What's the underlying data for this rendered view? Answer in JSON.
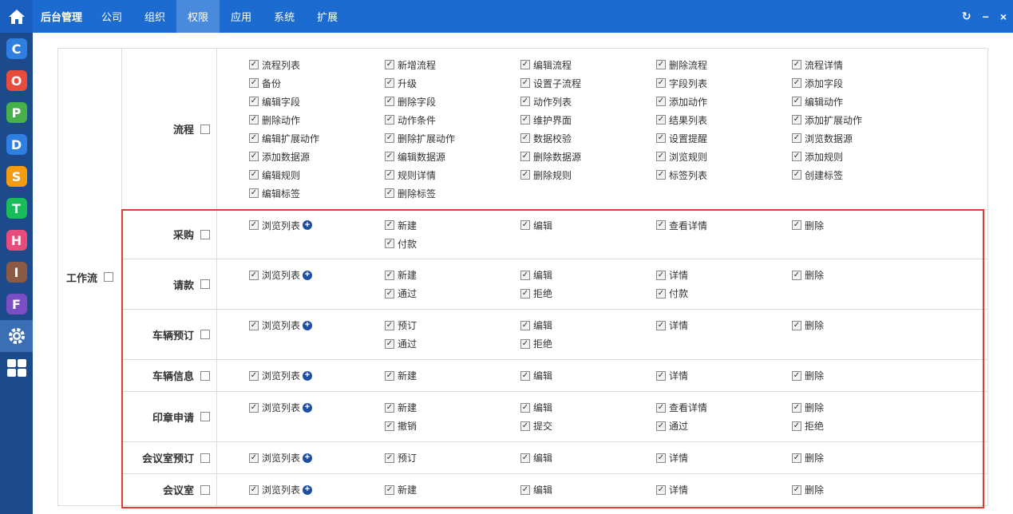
{
  "brand": "后台管理",
  "nav": [
    {
      "label": "公司",
      "active": false
    },
    {
      "label": "组织",
      "active": false
    },
    {
      "label": "权限",
      "active": true
    },
    {
      "label": "应用",
      "active": false
    },
    {
      "label": "系统",
      "active": false
    },
    {
      "label": "扩展",
      "active": false
    }
  ],
  "window_controls": {
    "refresh": "↻",
    "minimize": "−",
    "close": "×"
  },
  "sidebar": [
    {
      "letter": "C",
      "color": "#2f7fe0",
      "name": "sidebar-app-c"
    },
    {
      "letter": "O",
      "color": "#e84c3d",
      "name": "sidebar-app-o"
    },
    {
      "letter": "P",
      "color": "#46b14b",
      "name": "sidebar-app-p"
    },
    {
      "letter": "D",
      "color": "#2f7fe0",
      "name": "sidebar-app-d"
    },
    {
      "letter": "S",
      "color": "#f39c12",
      "name": "sidebar-app-s"
    },
    {
      "letter": "T",
      "color": "#1abc5a",
      "name": "sidebar-app-t"
    },
    {
      "letter": "H",
      "color": "#e84c7d",
      "name": "sidebar-app-h"
    },
    {
      "letter": "I",
      "color": "#8a5a44",
      "name": "sidebar-app-i"
    },
    {
      "letter": "F",
      "color": "#7b4fc4",
      "name": "sidebar-app-f"
    }
  ],
  "group_label": "工作流",
  "sections": [
    {
      "label": "流程",
      "items": [
        {
          "t": "流程列表"
        },
        {
          "t": "新增流程"
        },
        {
          "t": "编辑流程"
        },
        {
          "t": "删除流程"
        },
        {
          "t": "流程详情"
        },
        {
          "t": "备份"
        },
        {
          "t": "升级"
        },
        {
          "t": "设置子流程"
        },
        {
          "t": "字段列表"
        },
        {
          "t": "添加字段"
        },
        {
          "t": "编辑字段"
        },
        {
          "t": "删除字段"
        },
        {
          "t": "动作列表"
        },
        {
          "t": "添加动作"
        },
        {
          "t": "编辑动作"
        },
        {
          "t": "删除动作"
        },
        {
          "t": "动作条件"
        },
        {
          "t": "维护界面"
        },
        {
          "t": "结果列表"
        },
        {
          "t": "添加扩展动作"
        },
        {
          "t": "编辑扩展动作"
        },
        {
          "t": "删除扩展动作"
        },
        {
          "t": "数据校验"
        },
        {
          "t": "设置提醒"
        },
        {
          "t": "浏览数据源"
        },
        {
          "t": "添加数据源"
        },
        {
          "t": "编辑数据源"
        },
        {
          "t": "删除数据源"
        },
        {
          "t": "浏览规则"
        },
        {
          "t": "添加规则"
        },
        {
          "t": "编辑规则"
        },
        {
          "t": "规则详情"
        },
        {
          "t": "删除规则"
        },
        {
          "t": "标签列表"
        },
        {
          "t": "创建标签"
        },
        {
          "t": "编辑标签"
        },
        {
          "t": "删除标签"
        }
      ]
    },
    {
      "label": "采购",
      "items": [
        {
          "t": "浏览列表",
          "plus": true
        },
        {
          "t": "新建"
        },
        {
          "t": "编辑"
        },
        {
          "t": "查看详情"
        },
        {
          "t": "删除"
        },
        {
          "t": "",
          "empty": true
        },
        {
          "t": "付款"
        }
      ]
    },
    {
      "label": "请款",
      "items": [
        {
          "t": "浏览列表",
          "plus": true
        },
        {
          "t": "新建"
        },
        {
          "t": "编辑"
        },
        {
          "t": "详情"
        },
        {
          "t": "删除"
        },
        {
          "t": "",
          "empty": true
        },
        {
          "t": "通过"
        },
        {
          "t": "拒绝"
        },
        {
          "t": "付款"
        }
      ]
    },
    {
      "label": "车辆预订",
      "items": [
        {
          "t": "浏览列表",
          "plus": true
        },
        {
          "t": "预订"
        },
        {
          "t": "编辑"
        },
        {
          "t": "详情"
        },
        {
          "t": "删除"
        },
        {
          "t": "",
          "empty": true
        },
        {
          "t": "通过"
        },
        {
          "t": "拒绝"
        }
      ]
    },
    {
      "label": "车辆信息",
      "items": [
        {
          "t": "浏览列表",
          "plus": true
        },
        {
          "t": "新建"
        },
        {
          "t": "编辑"
        },
        {
          "t": "详情"
        },
        {
          "t": "删除"
        }
      ]
    },
    {
      "label": "印章申请",
      "items": [
        {
          "t": "浏览列表",
          "plus": true
        },
        {
          "t": "新建"
        },
        {
          "t": "编辑"
        },
        {
          "t": "查看详情"
        },
        {
          "t": "删除"
        },
        {
          "t": "",
          "empty": true
        },
        {
          "t": "撤销"
        },
        {
          "t": "提交"
        },
        {
          "t": "通过"
        },
        {
          "t": "拒绝"
        }
      ]
    },
    {
      "label": "会议室预订",
      "items": [
        {
          "t": "浏览列表",
          "plus": true
        },
        {
          "t": "预订"
        },
        {
          "t": "编辑"
        },
        {
          "t": "详情"
        },
        {
          "t": "删除"
        }
      ]
    },
    {
      "label": "会议室",
      "items": [
        {
          "t": "浏览列表",
          "plus": true
        },
        {
          "t": "新建"
        },
        {
          "t": "编辑"
        },
        {
          "t": "详情"
        },
        {
          "t": "删除"
        }
      ]
    }
  ],
  "colors": {
    "topbar": "#1c6bd1",
    "sidebar": "#1c4a8a",
    "highlight": "#e53935"
  }
}
